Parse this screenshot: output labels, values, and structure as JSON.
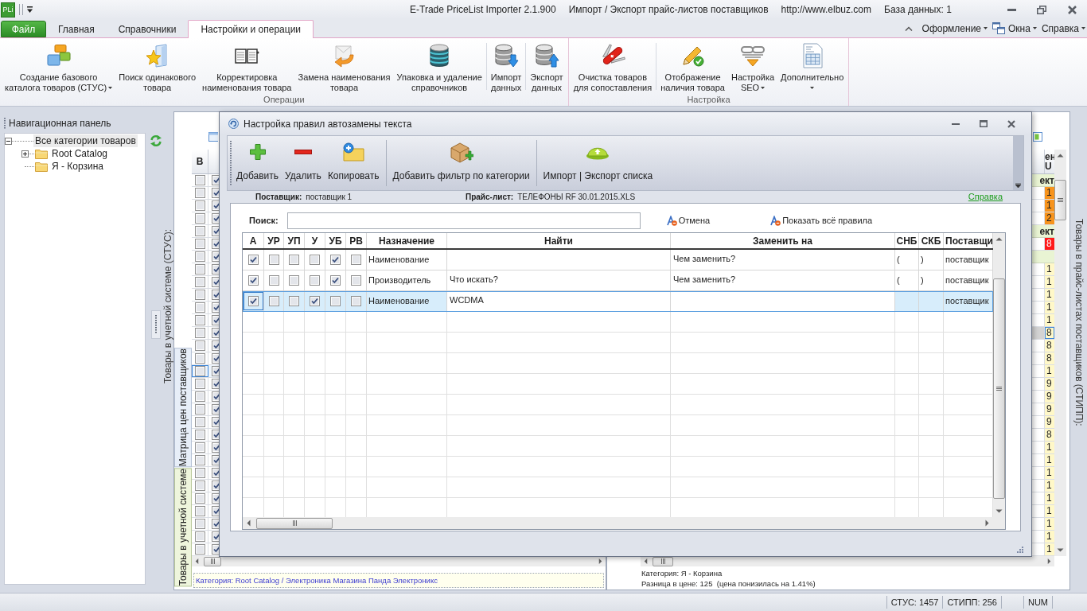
{
  "app": {
    "logo": "PLi",
    "title_parts": [
      "E-Trade PriceList Importer 2.1.900",
      "Импорт / Экспорт прайс-листов поставщиков",
      "http://www.elbuz.com",
      "База данных: 1"
    ]
  },
  "ribbon_tabs": [
    {
      "label": "Файл",
      "kind": "file",
      "selected": false
    },
    {
      "label": "Главная",
      "kind": "tab",
      "selected": false
    },
    {
      "label": "Справочники",
      "kind": "tab",
      "selected": false
    },
    {
      "label": "Настройки и операции",
      "kind": "tab",
      "selected": true
    }
  ],
  "ribbon_menus": [
    {
      "label": "Оформление",
      "dropdown": true
    },
    {
      "label": "Окна",
      "dropdown": true
    },
    {
      "label": "Справка",
      "dropdown": true
    }
  ],
  "ribbon_groups": [
    {
      "label": "Операции",
      "sections": [
        [
          {
            "label": "Создание базового\nкаталога товаров (СТУС)",
            "dropdown": true
          },
          {
            "label": "Поиск одинакового\nтовара",
            "dropdown": false
          },
          {
            "label": "Корректировка\nнаименования товара",
            "dropdown": false
          },
          {
            "label": "Замена наименования\nтовара",
            "dropdown": false
          },
          {
            "label": "Упаковка и удаление\nсправочников",
            "dropdown": false
          }
        ],
        [
          {
            "label": "Импорт\nданных",
            "dropdown": false
          }
        ],
        [
          {
            "label": "Экспорт\nданных",
            "dropdown": false
          }
        ]
      ]
    },
    {
      "label": "Настройка",
      "sections": [
        [
          {
            "label": "Очистка товаров\nдля сопоставления",
            "dropdown": false
          }
        ],
        [
          {
            "label": "Отображение\nналичия товара",
            "dropdown": false
          },
          {
            "label": "Настройка\nSEO",
            "dropdown": true
          },
          {
            "label": "Дополнительно",
            "dropdown": true
          }
        ]
      ]
    }
  ],
  "nav_panel": {
    "title": "Навигационная панель",
    "tree": [
      {
        "label": "Все категории товаров",
        "expanded": true,
        "selected": true,
        "children": [
          {
            "label": "Root Catalog",
            "expanded": false,
            "selected": false
          },
          {
            "label": "Я - Корзина",
            "selected": false
          }
        ]
      }
    ]
  },
  "side_tabs": [
    {
      "label": "Матрица цен поставщиков",
      "selected": false
    },
    {
      "label": "Товары в учетной системе",
      "selected": true
    }
  ],
  "stus_pane": {
    "title": "Товары в учетной системе (СТУС):",
    "grid": {
      "columns": [
        "В"
      ],
      "rows": [
        {
          "checked": [
            false,
            true
          ],
          "selected": false
        },
        {
          "checked": [
            false,
            true
          ],
          "selected": false
        },
        {
          "checked": [
            false,
            true
          ],
          "selected": false
        },
        {
          "checked": [
            false,
            true
          ],
          "selected": false
        },
        {
          "checked": [
            false,
            true
          ],
          "selected": false
        },
        {
          "checked": [
            false,
            true
          ],
          "selected": false
        },
        {
          "checked": [
            false,
            true
          ],
          "selected": false
        },
        {
          "checked": [
            false,
            true
          ],
          "selected": false
        },
        {
          "checked": [
            false,
            true
          ],
          "selected": false
        },
        {
          "checked": [
            false,
            true
          ],
          "selected": false
        },
        {
          "checked": [
            false,
            true
          ],
          "selected": false
        },
        {
          "checked": [
            false,
            true
          ],
          "selected": false
        },
        {
          "checked": [
            false,
            true
          ],
          "selected": false
        },
        {
          "checked": [
            false,
            true
          ],
          "selected": false
        },
        {
          "checked": [
            false,
            true
          ],
          "selected": false
        },
        {
          "checked": [
            false,
            true
          ],
          "selected": true
        },
        {
          "checked": [
            false,
            true
          ],
          "selected": false
        },
        {
          "checked": [
            false,
            true
          ],
          "selected": false
        },
        {
          "checked": [
            false,
            true
          ],
          "selected": false
        },
        {
          "checked": [
            false,
            true
          ],
          "selected": false
        },
        {
          "checked": [
            false,
            true
          ],
          "selected": false
        },
        {
          "checked": [
            false,
            true
          ],
          "selected": false
        },
        {
          "checked": [
            false,
            true
          ],
          "selected": false
        },
        {
          "checked": [
            false,
            true
          ],
          "selected": false
        },
        {
          "checked": [
            false,
            true
          ],
          "selected": false
        },
        {
          "checked": [
            false,
            true
          ],
          "selected": false
        },
        {
          "checked": [
            false,
            true
          ],
          "selected": false
        },
        {
          "checked": [
            false,
            true
          ],
          "selected": false
        },
        {
          "checked": [
            false,
            true
          ],
          "selected": false
        },
        {
          "checked": [
            false,
            true
          ],
          "selected": false
        }
      ]
    },
    "category": "Категория: Root Catalog / Электроника Магазина Панда Электроникс"
  },
  "stipp_pane": {
    "title": "Товары в прайс-листах поставщиков (СТИПП):",
    "grid": {
      "header": "ен\nU",
      "rows": [
        {
          "kind": "group",
          "label": "ект",
          "selected": false
        },
        {
          "kind": "item",
          "value": "1",
          "color": "#f7941d",
          "selected": false
        },
        {
          "kind": "item",
          "value": "1",
          "color": "#f7941d",
          "selected": false
        },
        {
          "kind": "item",
          "value": "2",
          "color": "#f7941d",
          "selected": false
        },
        {
          "kind": "group",
          "label": "ект",
          "selected": false
        },
        {
          "kind": "item",
          "value": "8",
          "color": "#ff1a1a",
          "selected": false
        },
        {
          "kind": "group",
          "selected": false
        },
        {
          "kind": "item",
          "value": "1",
          "color": "#fff8c8",
          "selected": false
        },
        {
          "kind": "item",
          "value": "1",
          "color": "#fff8c8",
          "selected": false
        },
        {
          "kind": "item",
          "value": "1",
          "color": "#fff8c8",
          "selected": false
        },
        {
          "kind": "item",
          "value": "1",
          "color": "#fff8c8",
          "selected": false
        },
        {
          "kind": "item",
          "value": "1",
          "color": "#fff8c8",
          "selected": false
        },
        {
          "kind": "item",
          "value": "8",
          "color": "#fff8c8",
          "selected": true
        },
        {
          "kind": "item",
          "value": "8",
          "color": "#fff8c8",
          "selected": false
        },
        {
          "kind": "item",
          "value": "8",
          "color": "#fff8c8",
          "selected": false
        },
        {
          "kind": "item",
          "value": "1",
          "color": "#fff8c8",
          "selected": false
        },
        {
          "kind": "item",
          "value": "9",
          "color": "#fff8c8",
          "selected": false
        },
        {
          "kind": "item",
          "value": "9",
          "color": "#fff8c8",
          "selected": false
        },
        {
          "kind": "item",
          "value": "9",
          "color": "#fff8c8",
          "selected": false
        },
        {
          "kind": "item",
          "value": "9",
          "color": "#fff8c8",
          "selected": false
        },
        {
          "kind": "item",
          "value": "8",
          "color": "#fff8c8",
          "selected": false
        },
        {
          "kind": "item",
          "value": "1",
          "color": "#fff8c8",
          "selected": false
        },
        {
          "kind": "item",
          "value": "1",
          "color": "#fff8c8",
          "selected": false
        },
        {
          "kind": "item",
          "value": "1",
          "color": "#fff8c8",
          "selected": false
        },
        {
          "kind": "item",
          "value": "1",
          "color": "#fff8c8",
          "selected": false
        },
        {
          "kind": "item",
          "value": "1",
          "color": "#fff8c8",
          "selected": false
        },
        {
          "kind": "item",
          "value": "1",
          "color": "#fff8c8",
          "selected": false
        },
        {
          "kind": "item",
          "value": "1",
          "color": "#fff8c8",
          "selected": false
        },
        {
          "kind": "item",
          "value": "1",
          "color": "#fff8c8",
          "selected": false
        },
        {
          "kind": "item",
          "value": "1",
          "color": "#fff8c8",
          "selected": false
        }
      ]
    },
    "category": "Категория: Я - Корзина",
    "price_difference": "Разница в цене: 125  (цена понизилась на 1.41%)"
  },
  "dialog": {
    "title": "Настройка правил автозамены текста",
    "toolbar": [
      [
        {
          "label": "Добавить"
        },
        {
          "label": "Удалить"
        },
        {
          "label": "Копировать"
        }
      ],
      [
        {
          "label": "Добавить фильтр по категории"
        }
      ],
      [
        {
          "label": "Импорт | Экспорт списка"
        }
      ]
    ],
    "supplier": {
      "label": "Поставщик:",
      "value": "поставщик 1"
    },
    "price_list": {
      "label": "Прайс-лист:",
      "value": "ТЕЛЕФОНЫ RF 30.01.2015.XLS"
    },
    "help_link": "Справка",
    "search": {
      "label": "Поиск:"
    },
    "actions": [
      {
        "label": "Отмена"
      },
      {
        "label": "Показать всё правила"
      }
    ],
    "grid": {
      "columns": [
        "А",
        "УР",
        "УП",
        "У",
        "УБ",
        "РВ",
        "Назначение",
        "Найти",
        "Заменить на",
        "СНБ",
        "СКБ",
        "Поставщи"
      ],
      "rows": [
        {
          "selected": false,
          "cells": [
            {
              "kind": "check",
              "checked": true
            },
            {
              "kind": "check",
              "checked": false
            },
            {
              "kind": "check",
              "checked": false
            },
            {
              "kind": "check",
              "checked": false
            },
            {
              "kind": "check",
              "checked": true
            },
            {
              "kind": "check",
              "checked": false
            },
            {
              "kind": "text",
              "text": "Наименование"
            },
            {
              "kind": "text"
            },
            {
              "kind": "text",
              "text": "Чем заменить?"
            },
            {
              "kind": "text",
              "text": "("
            },
            {
              "kind": "text",
              "text": ")"
            },
            {
              "kind": "text",
              "text": "поставщик"
            }
          ]
        },
        {
          "selected": false,
          "cells": [
            {
              "kind": "check",
              "checked": true
            },
            {
              "kind": "check",
              "checked": false
            },
            {
              "kind": "check",
              "checked": false
            },
            {
              "kind": "check",
              "checked": false
            },
            {
              "kind": "check",
              "checked": true
            },
            {
              "kind": "check",
              "checked": false
            },
            {
              "kind": "text",
              "text": "Производитель"
            },
            {
              "kind": "text",
              "text": "Что искать?"
            },
            {
              "kind": "text",
              "text": "Чем заменить?"
            },
            {
              "kind": "text",
              "text": "("
            },
            {
              "kind": "text",
              "text": ")"
            },
            {
              "kind": "text",
              "text": "поставщик"
            }
          ]
        },
        {
          "selected": true,
          "cells": [
            {
              "kind": "check",
              "checked": true
            },
            {
              "kind": "check",
              "checked": false
            },
            {
              "kind": "check",
              "checked": false
            },
            {
              "kind": "check",
              "checked": true
            },
            {
              "kind": "check",
              "checked": false
            },
            {
              "kind": "check",
              "checked": false
            },
            {
              "kind": "text",
              "text": "Наименование"
            },
            {
              "kind": "text",
              "text": "WCDMA"
            },
            {
              "kind": "text"
            },
            {
              "kind": "text"
            },
            {
              "kind": "text"
            },
            {
              "kind": "text",
              "text": "поставщик"
            }
          ]
        }
      ]
    }
  },
  "status_bar": [
    {
      "text": "СТУС: 1457"
    },
    {
      "text": "СТИПП: 256"
    },
    {
      "text": "NUM"
    }
  ]
}
